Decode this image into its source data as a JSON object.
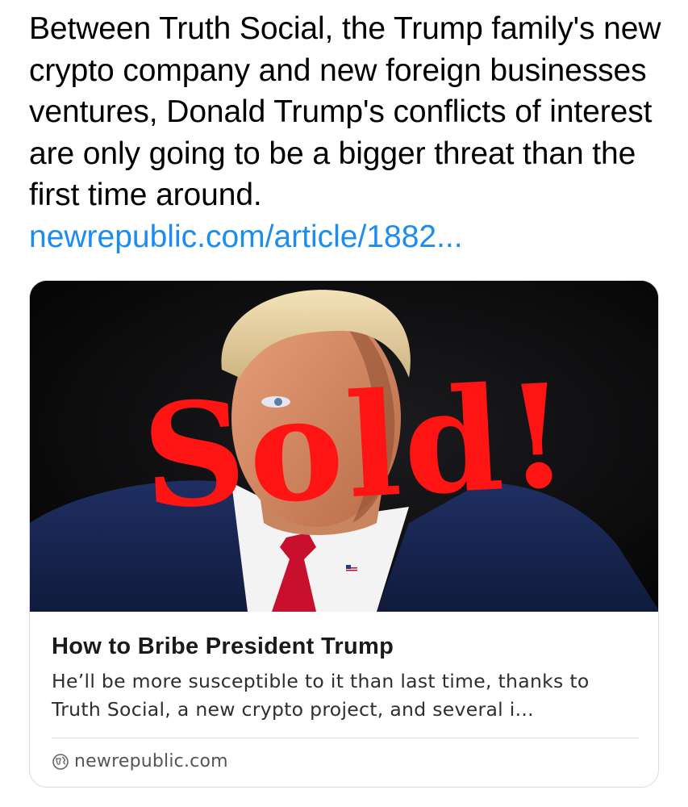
{
  "post": {
    "text": "Between Truth Social, the Trump family's new crypto company and new foreign businesses ventures, Donald Trump's conflicts of interest are only going to be a bigger threat than the first time around.",
    "link_text": "newrepublic.com/article/1882..."
  },
  "card": {
    "overlay_text": "Sold!",
    "title": "How to Bribe President Trump",
    "description": "He’ll be more susceptible to it than last time, thanks to Truth Social, a new crypto project, and several i...",
    "domain": "newrepublic.com",
    "domain_icon": "globe-icon"
  },
  "colors": {
    "link": "#1d8cf0",
    "overlay_text": "#ff1414",
    "image_background": "#080808"
  }
}
